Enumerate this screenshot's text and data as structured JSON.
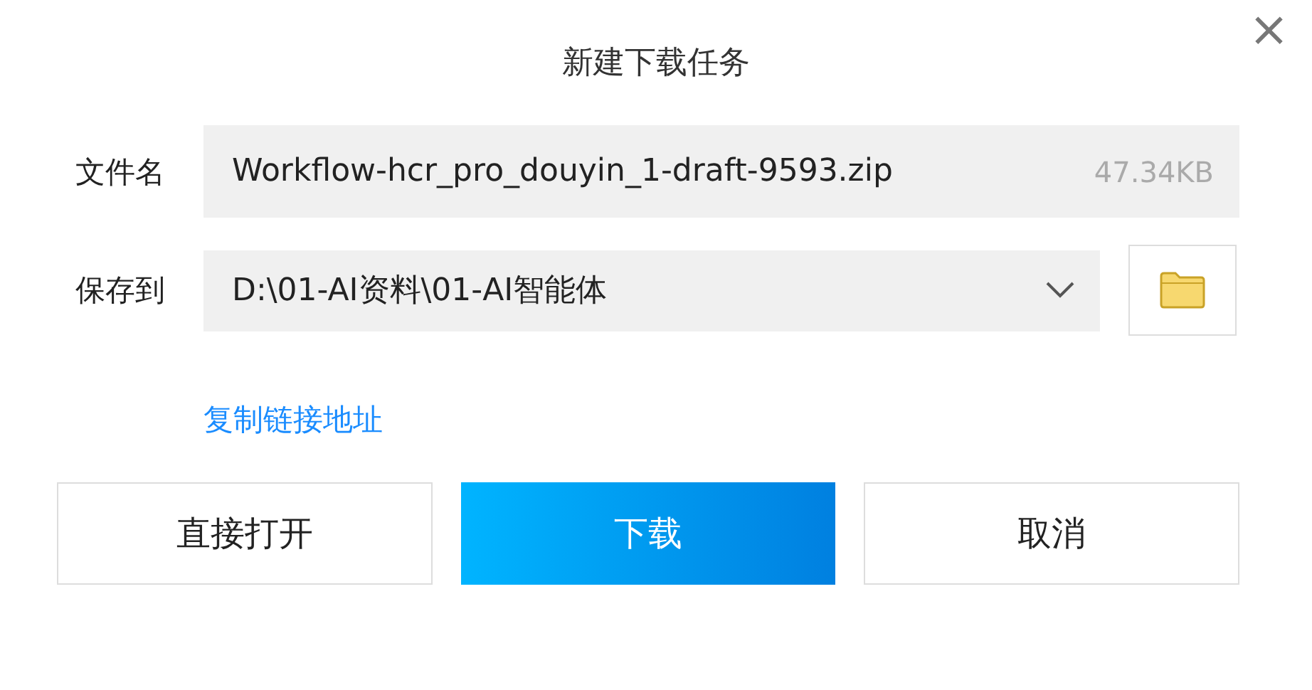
{
  "window": {
    "title": "新建下载任务",
    "close": "×"
  },
  "fields": [
    {
      "kind": "text",
      "label": "文件名",
      "value": "Workflow-hcr_pro_douyin_1-draft-9593.zip",
      "size": "47.34KB"
    },
    {
      "kind": "dropdown",
      "label": "保存到",
      "value": "D:\\01-AI资料\\01-AI智能体"
    }
  ],
  "link": "复制链接地址",
  "buttons": [
    {
      "label": "直接打开",
      "kind": "secondary"
    },
    {
      "label": "下载",
      "kind": "primary"
    },
    {
      "label": "取消",
      "kind": "secondary"
    }
  ]
}
